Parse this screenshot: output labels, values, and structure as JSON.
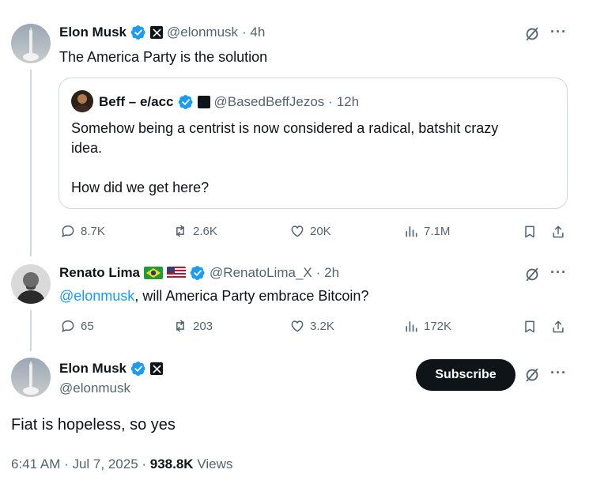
{
  "tweet1": {
    "name": "Elon Musk",
    "handle": "@elonmusk",
    "time": "· 4h",
    "text": "The America Party is the solution",
    "quote": {
      "name": "Beff – e/acc",
      "handle": "@BasedBeffJezos",
      "time": "· 12h",
      "line1": "Somehow being a centrist is now considered a radical, batshit crazy",
      "line2": "idea.",
      "line3": "How did we get here?"
    },
    "stats": {
      "replies": "8.7K",
      "reposts": "2.6K",
      "likes": "20K",
      "views": "7.1M"
    }
  },
  "tweet2": {
    "name": "Renato Lima",
    "handle": "@RenatoLima_X",
    "time": "· 2h",
    "mention": "@elonmusk",
    "text": ", will America Party embrace Bitcoin?",
    "stats": {
      "replies": "65",
      "reposts": "203",
      "likes": "3.2K",
      "views": "172K"
    }
  },
  "tweet3": {
    "name": "Elon Musk",
    "handle": "@elonmusk",
    "subscribe_label": "Subscribe",
    "text": "Fiat is hopeless, so yes",
    "timestamp": "6:41 AM · Jul 7, 2025 · ",
    "views_count": "938.8K",
    "views_label": " Views"
  },
  "more_label": "···",
  "colors": {
    "verified": "#1d9bf0",
    "text": "#0f1419",
    "secondary": "#536471",
    "link": "#1d9bf0"
  },
  "icons": [
    "verified-badge-icon",
    "x-logo-icon",
    "grok-icon",
    "more-icon",
    "reply-icon",
    "repost-icon",
    "like-icon",
    "views-icon",
    "bookmark-icon",
    "share-icon"
  ]
}
